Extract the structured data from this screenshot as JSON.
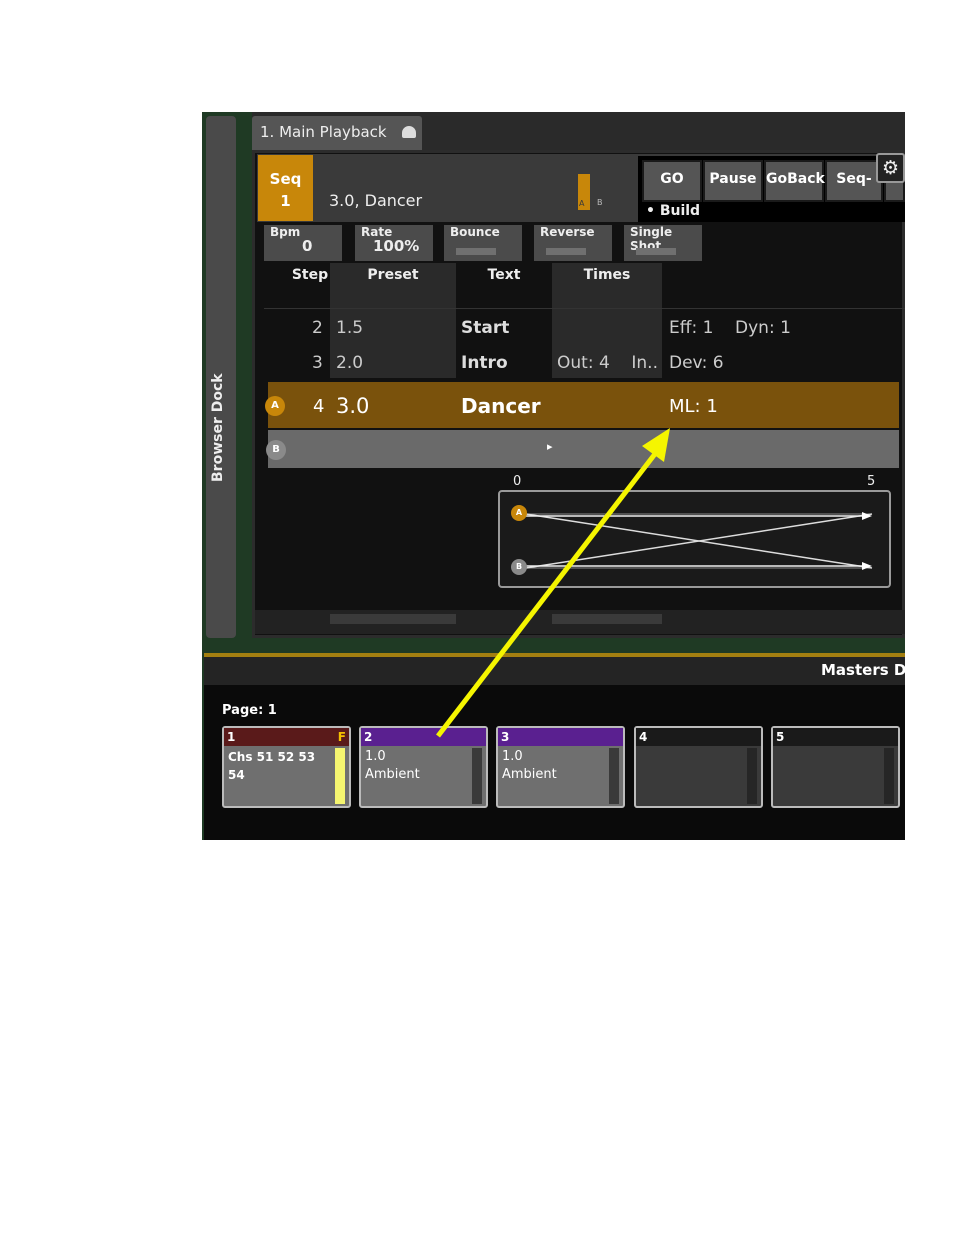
{
  "dock": {
    "label": "Browser Dock"
  },
  "playback": {
    "tab_title": "1. Main Playback",
    "seq_label": "Seq",
    "seq_number": "1",
    "current_cue": "3.0, Dancer",
    "ab_a": "A",
    "ab_b": "B",
    "buttons": [
      "GO",
      "Pause",
      "GoBack",
      "Seq-"
    ],
    "build_label": "• Build",
    "params": [
      {
        "label": "Bpm",
        "value": "0"
      },
      {
        "label": "Rate",
        "value": "100%"
      },
      {
        "label": "Bounce",
        "value": ""
      },
      {
        "label": "Reverse",
        "value": ""
      },
      {
        "label": "Single Shot",
        "value": ""
      }
    ],
    "columns": [
      "Step",
      "Preset",
      "Text",
      "Times"
    ],
    "rows": [
      {
        "step": "2",
        "preset": "1.5",
        "text": "Start",
        "times": "",
        "extra": "Eff: 1    Dyn: 1"
      },
      {
        "step": "3",
        "preset": "2.0",
        "text": "Intro",
        "times": "Out: 4    In..",
        "extra": "Dev: 6"
      }
    ],
    "active_row": {
      "badge": "A",
      "step": "4",
      "preset": "3.0",
      "text": "Dancer",
      "extra": "ML: 1"
    },
    "b_row": {
      "badge": "B",
      "marker": "▸"
    },
    "graph": {
      "min_label": "0",
      "max_label": "5",
      "a_badge": "A",
      "b_badge": "B"
    }
  },
  "masters": {
    "title": "Masters D",
    "page_label": "Page: 1",
    "faders": [
      {
        "num": "1",
        "flag": "F",
        "line1": "Chs 51 52 53",
        "line2": "54",
        "color": "#5a1a1a"
      },
      {
        "num": "2",
        "flag": "",
        "line1": "1.0",
        "line2": "Ambient",
        "color": "#5a2090"
      },
      {
        "num": "3",
        "flag": "",
        "line1": "1.0",
        "line2": "Ambient",
        "color": "#5a2090"
      },
      {
        "num": "4",
        "flag": "",
        "line1": "",
        "line2": "",
        "color": "#222222"
      },
      {
        "num": "5",
        "flag": "",
        "line1": "",
        "line2": "",
        "color": "#222222"
      }
    ]
  },
  "colors": {
    "accent": "#c8870a",
    "annotation_arrow": "#f5f500"
  }
}
